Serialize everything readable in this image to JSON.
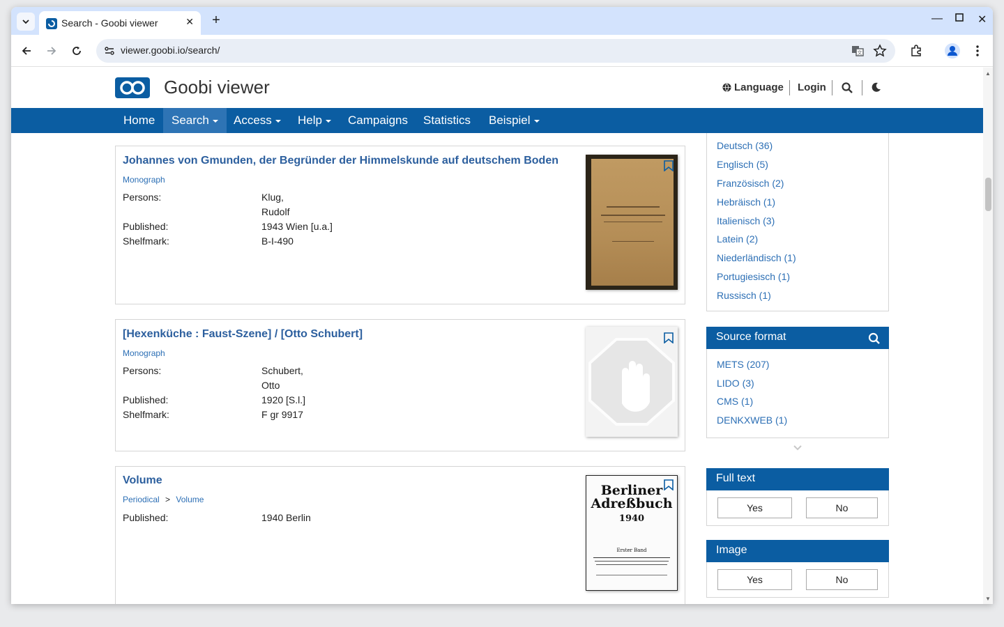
{
  "browser": {
    "tab_title": "Search - Goobi viewer",
    "url": "viewer.goobi.io/search/"
  },
  "header": {
    "site_title": "Goobi viewer",
    "language": "Language",
    "login": "Login"
  },
  "nav": {
    "home": "Home",
    "search": "Search",
    "access": "Access",
    "help": "Help",
    "campaigns": "Campaigns",
    "statistics": "Statistics",
    "beispiel": "Beispiel"
  },
  "results": [
    {
      "title": "Johannes von Gmunden, der Begründer der Himmelskunde auf deutschem Boden",
      "type": "Monograph",
      "persons_label": "Persons:",
      "persons": [
        "Klug,",
        "Rudolf"
      ],
      "published_label": "Published:",
      "published": "1943 Wien [u.a.]",
      "shelfmark_label": "Shelfmark:",
      "shelfmark": "B-I-490"
    },
    {
      "title": "[Hexenküche : Faust-Szene] / [Otto Schubert]",
      "type": "Monograph",
      "persons_label": "Persons:",
      "persons": [
        "Schubert,",
        "Otto"
      ],
      "published_label": "Published:",
      "published": "1920 [S.l.]",
      "shelfmark_label": "Shelfmark:",
      "shelfmark": "F gr 9917"
    },
    {
      "title": "Volume",
      "breadcrumb": [
        "Periodical",
        ">",
        "Volume"
      ],
      "published_label": "Published:",
      "published": "1940 Berlin",
      "thumb_text": [
        "Berliner",
        "Adreßbuch",
        "1940",
        "Erster Band"
      ]
    }
  ],
  "sidebar": {
    "languages": [
      "Deutsch (36)",
      "Englisch (5)",
      "Französisch (2)",
      "Hebräisch (1)",
      "Italienisch (3)",
      "Latein (2)",
      "Niederländisch (1)",
      "Portugiesisch (1)",
      "Russisch (1)"
    ],
    "source_format": {
      "title": "Source format",
      "items": [
        "METS (207)",
        "LIDO (3)",
        "CMS (1)",
        "DENKXWEB (1)"
      ]
    },
    "full_text": {
      "title": "Full text",
      "yes": "Yes",
      "no": "No"
    },
    "image": {
      "title": "Image",
      "yes": "Yes",
      "no": "No"
    }
  },
  "colors": {
    "brand": "#0b5da2",
    "link": "#2c5f9e"
  }
}
